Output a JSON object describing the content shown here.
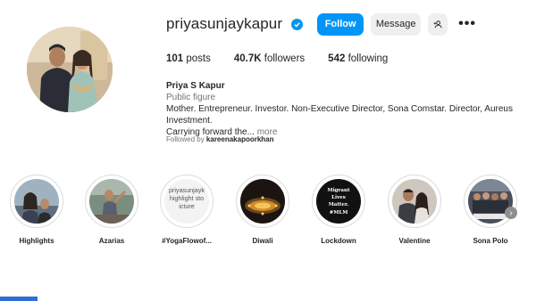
{
  "profile": {
    "username": "priyasunjaykapur",
    "follow_label": "Follow",
    "message_label": "Message",
    "more_label": "•••"
  },
  "stats": {
    "posts_count": "101",
    "posts_label": "posts",
    "followers_count": "40.7K",
    "followers_label": "followers",
    "following_count": "542",
    "following_label": "following"
  },
  "bio": {
    "name": "Priya S Kapur",
    "category": "Public figure",
    "line1": "Mother. Entrepreneur. Investor. Non-Executive Director, Sona Comstar. Director, Aureus Investment.",
    "line2": "Carrying forward the...",
    "more": "more",
    "followed_by_prefix": "Followed by",
    "followed_by_user": "kareenakapoorkhan"
  },
  "highlights": [
    {
      "label": "Highlights"
    },
    {
      "label": "Azarias"
    },
    {
      "label": "#YogaFlowof...",
      "image_text_1": "priyasunjayk",
      "image_text_2": "highlight sto",
      "image_text_3": "icture"
    },
    {
      "label": "Diwali"
    },
    {
      "label": "Lockdown",
      "image_text_1": "Migrant",
      "image_text_2": "Lives",
      "image_text_3": "Matter.",
      "image_text_4": "#MLM"
    },
    {
      "label": "Valentine"
    },
    {
      "label": "Sona Polo"
    }
  ],
  "colors": {
    "accent": "#0095f6",
    "secondary_button": "#efefef",
    "muted_text": "#737373"
  }
}
